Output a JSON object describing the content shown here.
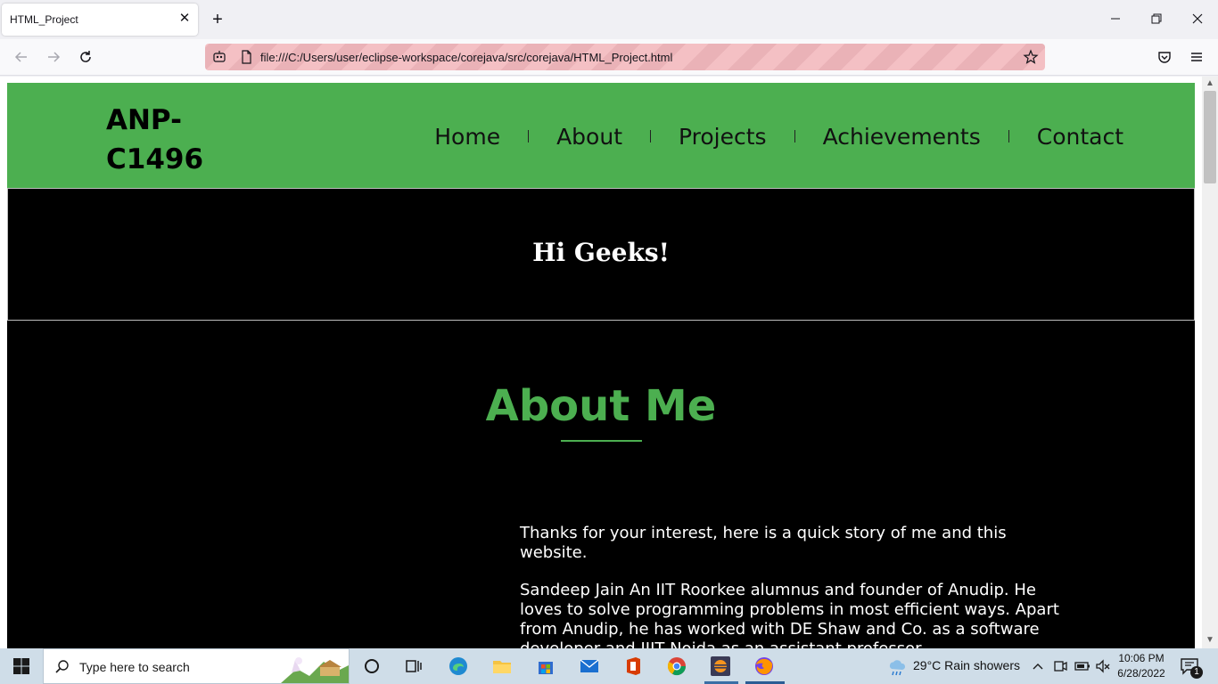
{
  "browser": {
    "tab_title": "HTML_Project",
    "url": "file:///C:/Users/user/eclipse-workspace/corejava/src/corejava/HTML_Project.html"
  },
  "site": {
    "logo_line1": "ANP-",
    "logo_line2": "C1496",
    "menu": [
      {
        "label": "Home"
      },
      {
        "label": "About"
      },
      {
        "label": "Projects"
      },
      {
        "label": "Achievements"
      },
      {
        "label": "Contact"
      }
    ],
    "hero_title": "Hi Geeks!",
    "about_heading": "About Me",
    "about_paragraphs": [
      "Thanks for your interest, here is a quick story of me and this website.",
      "Sandeep Jain An IIT Roorkee alumnus and founder of Anudip. He loves to solve programming problems in most efficient ways. Apart from Anudip, he has worked with DE Shaw and Co. as a software developer and JIIT Noida as an assistant professor."
    ],
    "colors": {
      "accent": "#4caf50",
      "hero_bg": "#000000",
      "text_light": "#ffffff"
    }
  },
  "taskbar": {
    "search_placeholder": "Type here to search",
    "weather": "29°C  Rain showers",
    "time": "10:06 PM",
    "date": "6/28/2022",
    "notification_count": "1"
  }
}
